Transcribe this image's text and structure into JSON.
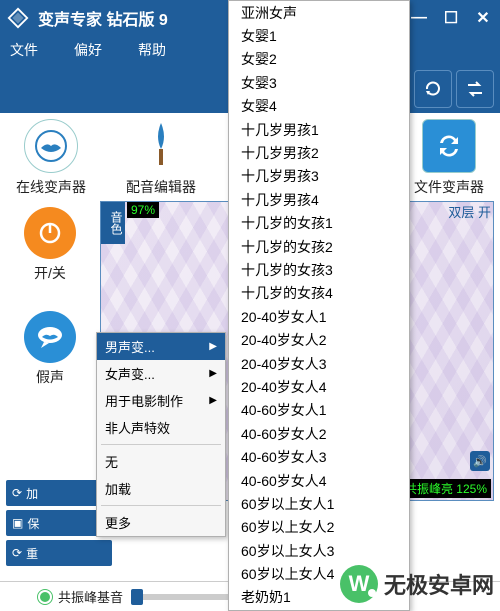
{
  "title": "变声专家 钻石版 9",
  "menubar": [
    "文件",
    "偏好",
    "帮助"
  ],
  "iconRowRight": [
    "lips-icon",
    "redo-icon",
    "swap-icon"
  ],
  "tools": [
    {
      "icon": "globe-lips",
      "label": "在线变声器"
    },
    {
      "icon": "brush",
      "label": "配音编辑器"
    },
    {
      "icon": "cycle",
      "label": "文件变声器"
    }
  ],
  "roundButtons": [
    {
      "color": "orange",
      "icon": "power",
      "label": "开/关"
    },
    {
      "color": "blue",
      "icon": "chat",
      "label": "假声"
    }
  ],
  "graph": {
    "yinse": "音色",
    "pct": "97%",
    "scLabel": "双层 开",
    "pct2": "125%",
    "pctLabel": "共振峰亮"
  },
  "bottomButtons": [
    "加",
    "保",
    "重"
  ],
  "statusbar": {
    "label": "共振峰基音"
  },
  "popup1": [
    {
      "label": "男声变...",
      "sel": true,
      "sub": true
    },
    {
      "label": "女声变...",
      "sub": true
    },
    {
      "label": "用于电影制作",
      "sub": true
    },
    {
      "label": "非人声特效"
    },
    {
      "sep": true
    },
    {
      "label": "无"
    },
    {
      "label": "加载"
    },
    {
      "sep": true
    },
    {
      "label": "更多"
    }
  ],
  "popup2": [
    "亚洲女声",
    "女婴1",
    "女婴2",
    "女婴3",
    "女婴4",
    "十几岁男孩1",
    "十几岁男孩2",
    "十几岁男孩3",
    "十几岁男孩4",
    "十几岁的女孩1",
    "十几岁的女孩2",
    "十几岁的女孩3",
    "十几岁的女孩4",
    "20-40岁女人1",
    "20-40岁女人2",
    "20-40岁女人3",
    "20-40岁女人4",
    "40-60岁女人1",
    "40-60岁女人2",
    "40-60岁女人3",
    "40-60岁女人4",
    "60岁以上女人1",
    "60岁以上女人2",
    "60岁以上女人3",
    "60岁以上女人4",
    "老奶奶1"
  ],
  "watermark": "无极安卓网"
}
